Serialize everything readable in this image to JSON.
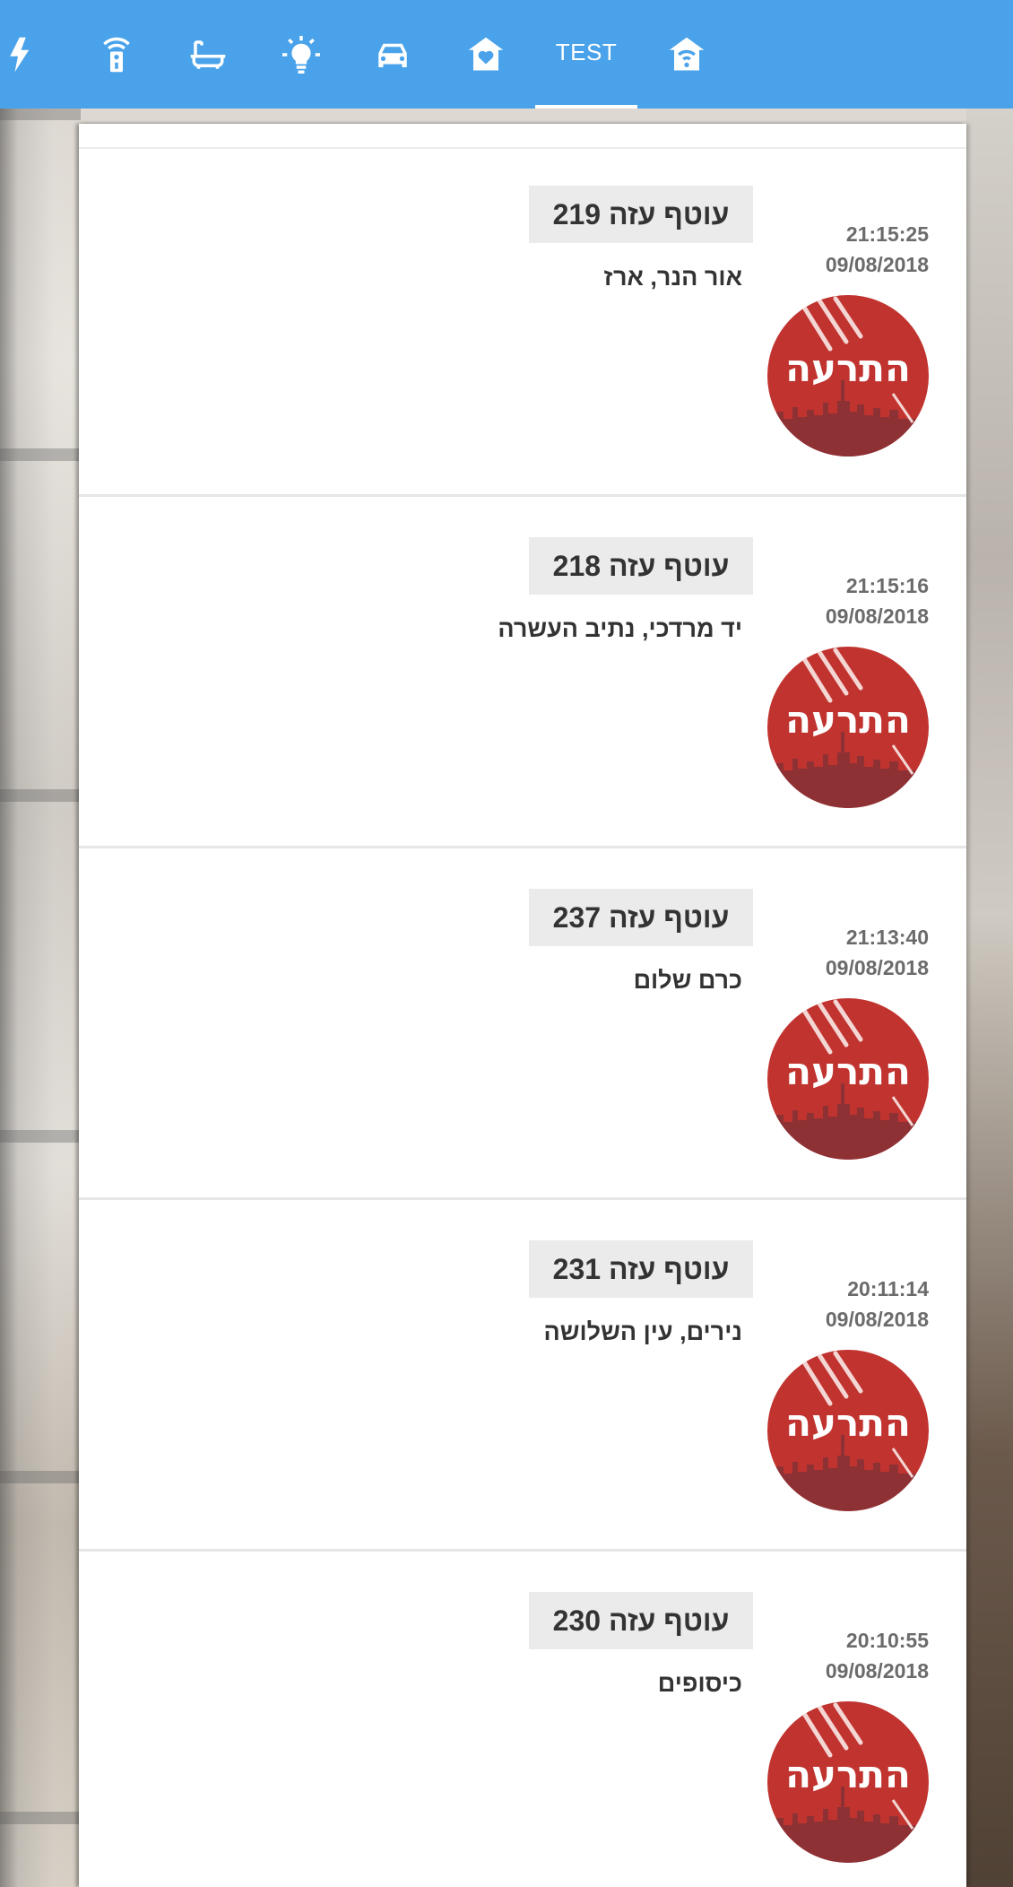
{
  "nav": {
    "items": [
      {
        "icon": "lightning-icon"
      },
      {
        "icon": "remote-control-icon"
      },
      {
        "icon": "bathtub-icon"
      },
      {
        "icon": "lightbulb-icon"
      },
      {
        "icon": "car-icon"
      },
      {
        "icon": "home-heart-icon"
      },
      {
        "label": "TEST",
        "active": true
      },
      {
        "icon": "home-wifi-icon"
      }
    ],
    "bar_color": "#4aa3ea"
  },
  "alerts": [
    {
      "time": "21:15:25",
      "date": "09/08/2018",
      "region": "עוטף עזה 219",
      "areas": "אור הנר, ארז",
      "logo_text": "התרעה"
    },
    {
      "time": "21:15:16",
      "date": "09/08/2018",
      "region": "עוטף עזה 218",
      "areas": "יד מרדכי, נתיב העשרה",
      "logo_text": "התרעה"
    },
    {
      "time": "21:13:40",
      "date": "09/08/2018",
      "region": "עוטף עזה 237",
      "areas": "כרם שלום",
      "logo_text": "התרעה"
    },
    {
      "time": "20:11:14",
      "date": "09/08/2018",
      "region": "עוטף עזה 231",
      "areas": "נירים, עין השלושה",
      "logo_text": "התרעה"
    },
    {
      "time": "20:10:55",
      "date": "09/08/2018",
      "region": "עוטף עזה 230",
      "areas": "כיסופים",
      "logo_text": "התרעה"
    }
  ],
  "colors": {
    "logo_red": "#c0332f",
    "logo_dark": "#8e3135"
  }
}
